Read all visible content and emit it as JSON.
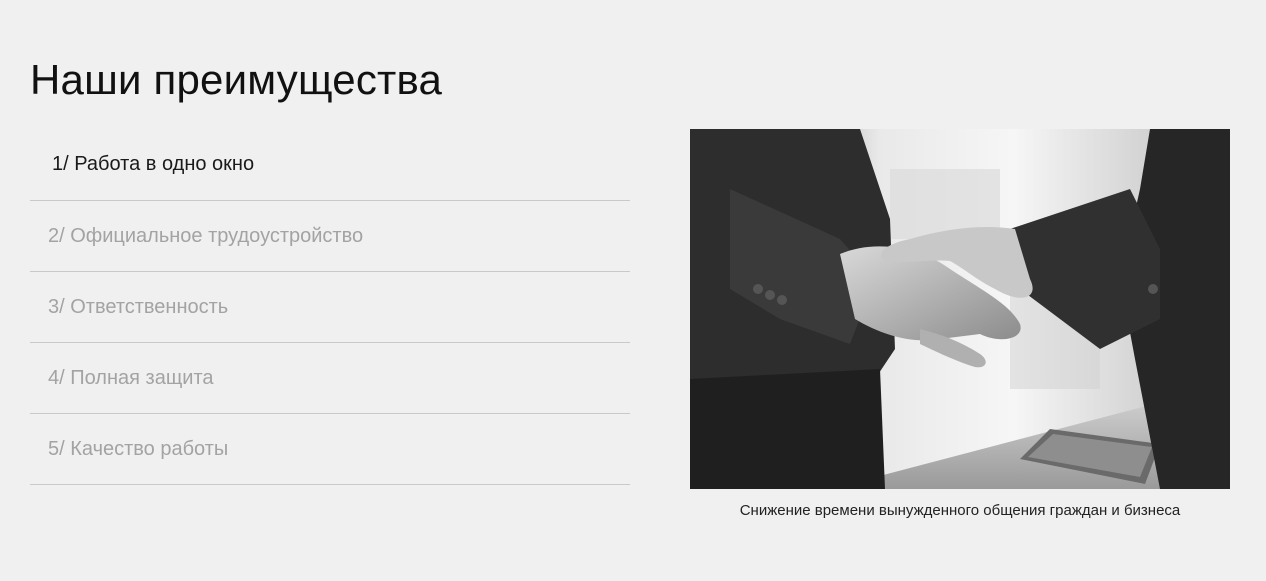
{
  "section": {
    "title": "Наши преимущества"
  },
  "tabs": [
    {
      "label": "1/ Работа в одно окно",
      "active": true
    },
    {
      "label": "2/ Официальное трудоустройство",
      "active": false
    },
    {
      "label": "3/ Ответственность",
      "active": false
    },
    {
      "label": "4/ Полная защита",
      "active": false
    },
    {
      "label": "5/ Качество работы",
      "active": false
    }
  ],
  "image": {
    "subject": "handshake-photo",
    "caption": "Снижение времени вынужденного общения граждан и бизнеса"
  }
}
